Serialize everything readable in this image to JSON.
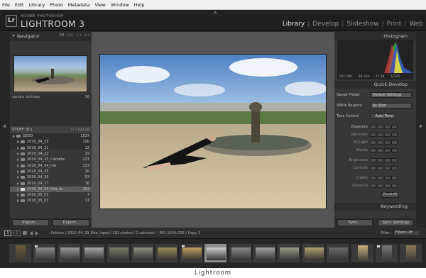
{
  "menu": [
    "File",
    "Edit",
    "Library",
    "Photo",
    "Metadata",
    "View",
    "Window",
    "Help"
  ],
  "app": {
    "logo": "Lr",
    "vendor": "ADOBE PHOTOSHOP",
    "name": "LIGHTROOM 3"
  },
  "modules": [
    "Library",
    "Develop",
    "Slideshow",
    "Print",
    "Web"
  ],
  "active_module": "Library",
  "navigator": {
    "title": "Navigator",
    "options": [
      "FIT",
      "FILL",
      "1:1",
      "3:1"
    ]
  },
  "collections": [
    {
      "name": "sandra birthday",
      "count": "36"
    }
  ],
  "drive": {
    "name": "STUFF (E:)",
    "space": "77 / 100 GB"
  },
  "folders": [
    {
      "name": "SSDD",
      "count": "1537",
      "root": true
    },
    {
      "name": "2010_04_19",
      "count": "190"
    },
    {
      "name": "2010_04_21",
      "count": "12"
    },
    {
      "name": "2010_04_22",
      "count": "29"
    },
    {
      "name": "2010_04_23_Carlotta",
      "count": "231"
    },
    {
      "name": "2010_04_24_Iria",
      "count": "133"
    },
    {
      "name": "2010_04_25",
      "count": "30"
    },
    {
      "name": "2010_04_26",
      "count": "53"
    },
    {
      "name": "2010_04_27",
      "count": "16"
    },
    {
      "name": "2010_04_29_Rita_lo...",
      "count": "192",
      "selected": true
    },
    {
      "name": "2010_05_01",
      "count": "7"
    },
    {
      "name": "2010_05_03",
      "count": "17"
    }
  ],
  "left_buttons": {
    "import": "Import...",
    "export": "Export..."
  },
  "histogram": {
    "title": "Histogram",
    "info": [
      "ISO 200",
      "28 mm",
      "f / 18",
      "1/125"
    ]
  },
  "quick_develop": {
    "title": "Quick Develop",
    "saved_preset": {
      "label": "Saved Preset",
      "value": "Default Settings"
    },
    "white_balance": {
      "label": "White Balance",
      "value": "As Shot"
    },
    "tone_control": {
      "label": "Tone Control",
      "value": "Auto Tone"
    },
    "adjustments": [
      "Exposure",
      "Recovery",
      "Fill Light",
      "Blacks",
      "Brightness",
      "Contrast",
      "Clarity",
      "Vibrance"
    ],
    "reset": "Reset All"
  },
  "keywording": {
    "title": "Keywording"
  },
  "right_buttons": {
    "sync": "Sync...",
    "sync_settings": "Sync Settings"
  },
  "filmstrip_bar": {
    "page1": "1",
    "page2": "2",
    "path": "Folders / 2010_04_29_Rita_lopes / 192 photos / 1 selected / _MG_1834.CR2 / Copy 2",
    "filter_label": "Filter :",
    "filter_value": "Filters Off"
  },
  "film_cells": [
    {
      "tone": "#6b5f3a",
      "portrait": true
    },
    {
      "tone": "#8a8a8a",
      "badge": true
    },
    {
      "tone": "#9a9a9a"
    },
    {
      "tone": "#a5a5a5"
    },
    {
      "tone": "#7a7a6a"
    },
    {
      "tone": "#8e8e80"
    },
    {
      "tone": "#9a8a5a"
    },
    {
      "tone": "#c0a060",
      "badge": true
    },
    {
      "tone": "#d0d0d0",
      "selected": true
    },
    {
      "tone": "#8a8a8a"
    },
    {
      "tone": "#a0a0a0"
    },
    {
      "tone": "#9a9a8a"
    },
    {
      "tone": "#b0a070"
    },
    {
      "tone": "#6a6a6a"
    },
    {
      "tone": "#c8b080",
      "portrait": true
    },
    {
      "tone": "#777",
      "portrait": true,
      "badge": true
    },
    {
      "tone": "#8a7a5a",
      "portrait": true
    }
  ],
  "caption": "Lightroom"
}
